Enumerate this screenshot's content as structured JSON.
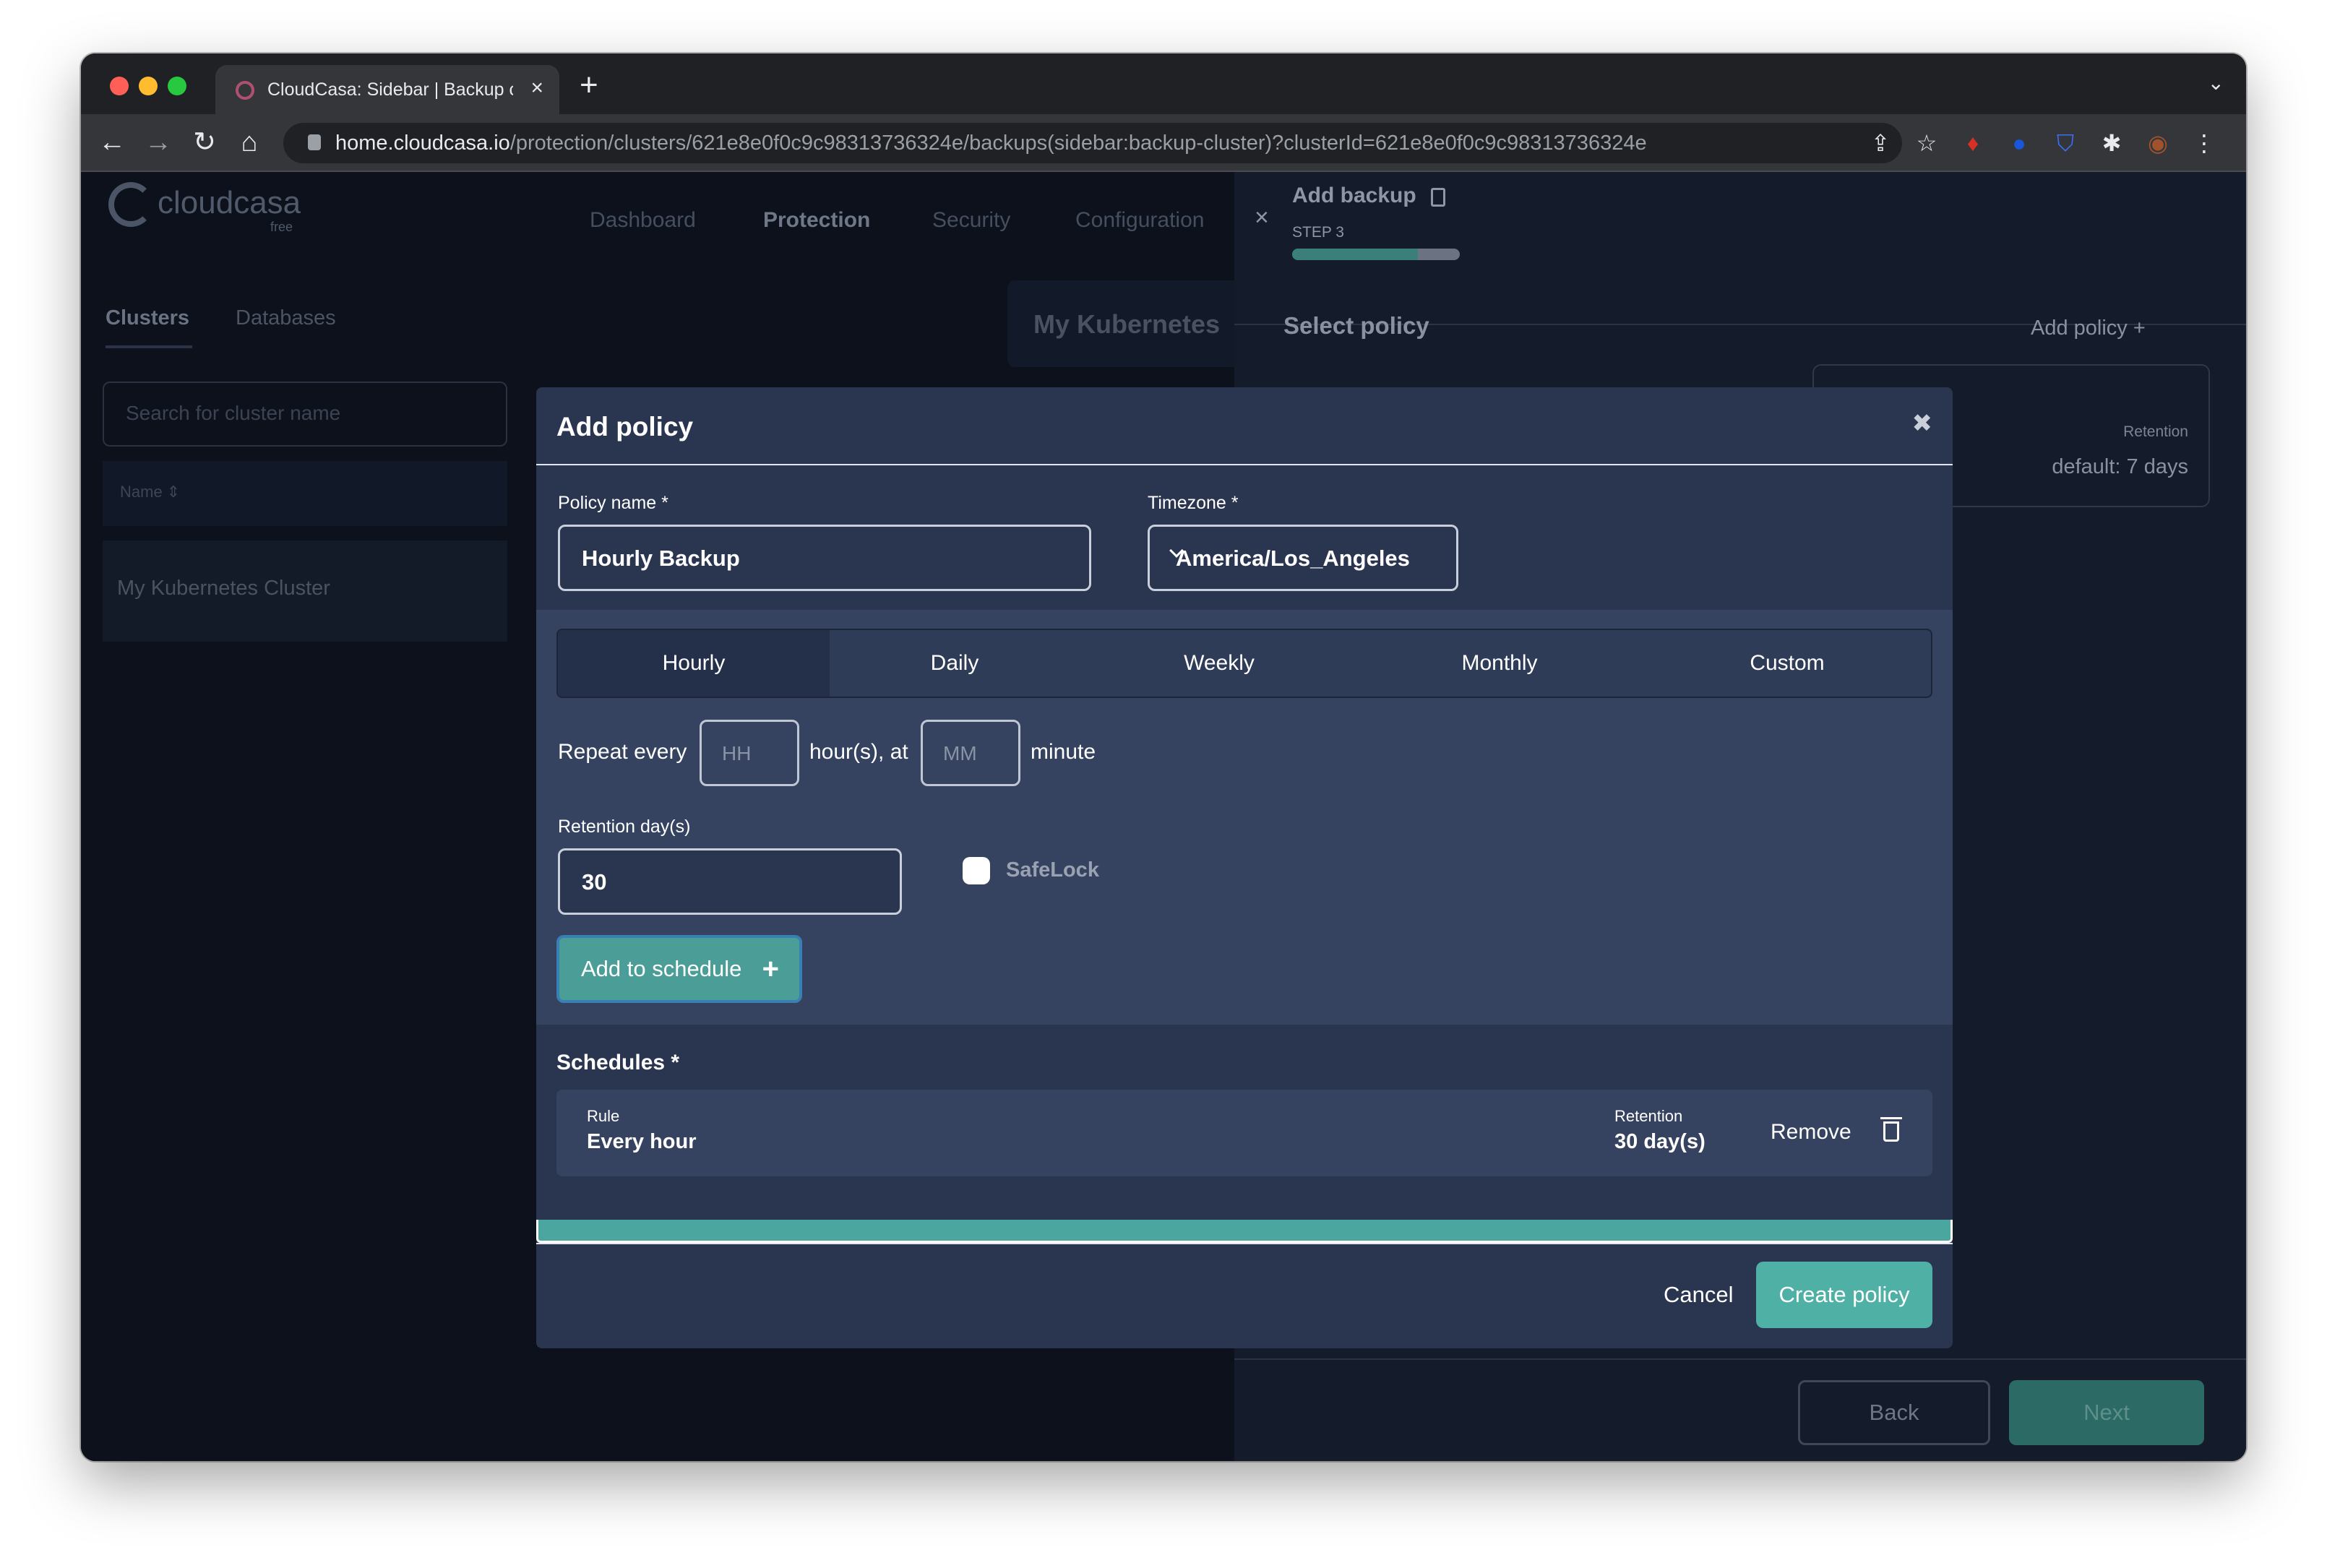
{
  "browser": {
    "tab_title": "CloudCasa: Sidebar | Backup c",
    "tab_close": "×",
    "new_tab": "+",
    "tabs_menu": "⌄",
    "back": "←",
    "forward": "→",
    "reload": "↻",
    "home": "⌂",
    "url_host": "home.cloudcasa.io",
    "url_path": "/protection/clusters/621e8e0f0c9c98313736324e/backups(sidebar:backup-cluster)?clusterId=621e8e0f0c9c98313736324e",
    "actions": [
      "⇪",
      "☆",
      "♦",
      "●",
      "⛉",
      "✱",
      "◉",
      "⋮"
    ]
  },
  "app": {
    "logo": "cloudcasa",
    "logo_sub": "free",
    "nav": [
      "Dashboard",
      "Protection",
      "Security",
      "Configuration"
    ],
    "subtabs": [
      "Clusters",
      "Databases"
    ],
    "search_placeholder": "Search for cluster name",
    "table_header": "Name ⇕",
    "cluster_name": "My Kubernetes Cluster",
    "card_title": "My Kubernetes"
  },
  "sidebar": {
    "close": "×",
    "title": "Add backup",
    "step": "STEP 3",
    "progress": 0.75,
    "heading": "Select policy",
    "add_policy": "Add policy +",
    "retention_label": "Retention",
    "retention_value": "default: 7 days",
    "back": "Back",
    "next": "Next"
  },
  "modal": {
    "title": "Add policy",
    "close": "✖",
    "policy_name_label": "Policy name *",
    "policy_name_value": "Hourly Backup",
    "timezone_label": "Timezone *",
    "timezone_value": "America/Los_Angeles",
    "tabs": [
      "Hourly",
      "Daily",
      "Weekly",
      "Monthly",
      "Custom"
    ],
    "repeat_every": "Repeat every",
    "hh_placeholder": "HH",
    "hours_at": "hour(s), at",
    "mm_placeholder": "MM",
    "minute": "minute",
    "retention_label": "Retention day(s)",
    "retention_value": "30",
    "safelock": "SafeLock",
    "add_to_schedule": "Add to schedule",
    "add_plus": "+",
    "schedules_label": "Schedules *",
    "schedule": {
      "rule_label": "Rule",
      "rule_value": "Every hour",
      "retention_label": "Retention",
      "retention_value": "30 day(s)",
      "remove": "Remove"
    },
    "cancel": "Cancel",
    "create": "Create policy"
  }
}
